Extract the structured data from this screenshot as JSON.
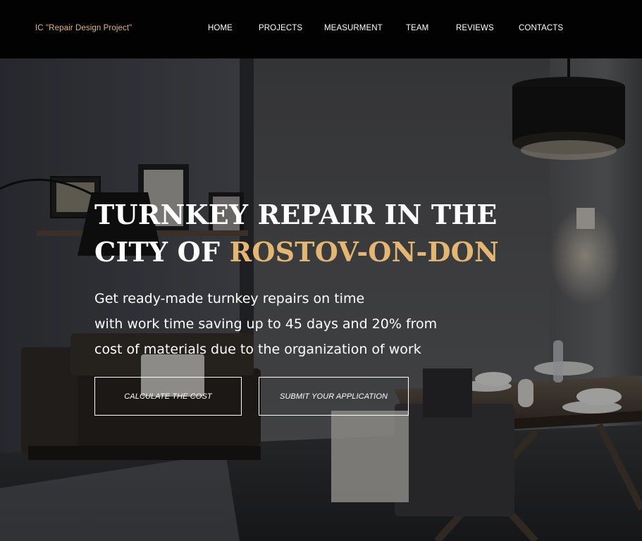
{
  "header": {
    "logo": "IC \"Repair Design Project\"",
    "nav": [
      "HOME",
      "PROJECTS",
      "MEASURMENT",
      "TEAM",
      "REVIEWS",
      "CONTACTS"
    ]
  },
  "hero": {
    "title_line1": "TURNKEY REPAIR IN THE",
    "title_line2_prefix": "CITY OF ",
    "title_line2_accent": "ROSTOV-ON-DON",
    "subtitle": [
      "Get ready-made turnkey repairs on time",
      "with work time saving up to 45 days and 20% from",
      "cost of materials due to the organization of work"
    ],
    "buttons": {
      "calculate": "CALCULATE THE COST",
      "submit": "SUBMIT YOUR APPLICATION"
    }
  },
  "colors": {
    "header_bg": "#020202",
    "accent": "#e4b671",
    "text": "#ffffff"
  }
}
